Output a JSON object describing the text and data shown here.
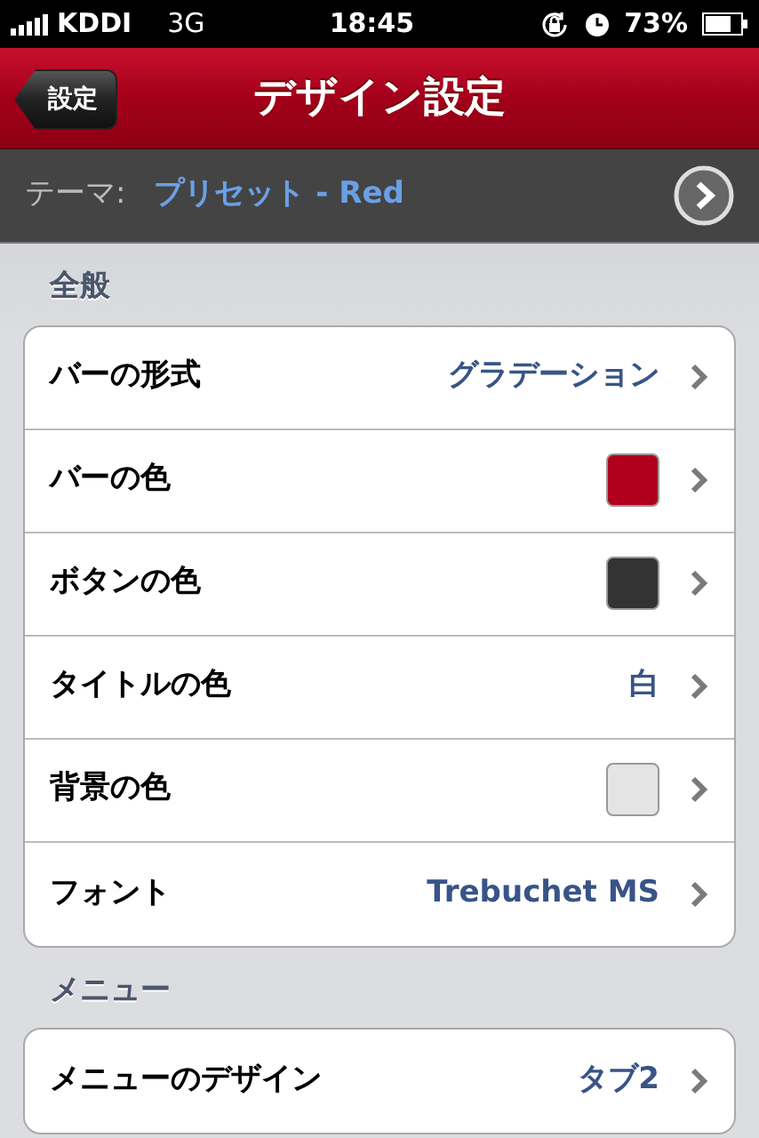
{
  "status_bar": {
    "carrier": "KDDI",
    "network": "3G",
    "time": "18:45",
    "battery": "73%"
  },
  "nav_bar": {
    "back": "設定",
    "title": "デザイン設定"
  },
  "theme_bar": {
    "label": "テーマ:",
    "value": "プリセット - Red"
  },
  "sections": [
    {
      "header": "全般",
      "rows": [
        {
          "kind": "value",
          "label": "バーの形式",
          "value": "グラデーション"
        },
        {
          "kind": "swatch",
          "label": "バーの色",
          "color": "#b0001e"
        },
        {
          "kind": "swatch",
          "label": "ボタンの色",
          "color": "#333333"
        },
        {
          "kind": "value",
          "label": "タイトルの色",
          "value": "白"
        },
        {
          "kind": "swatch",
          "label": "背景の色",
          "color": "#e4e4e4"
        },
        {
          "kind": "value",
          "label": "フォント",
          "value": "Trebuchet MS"
        }
      ]
    },
    {
      "header": "メニュー",
      "rows": [
        {
          "kind": "value",
          "label": "メニューのデザイン",
          "value": "タブ2"
        }
      ]
    }
  ]
}
